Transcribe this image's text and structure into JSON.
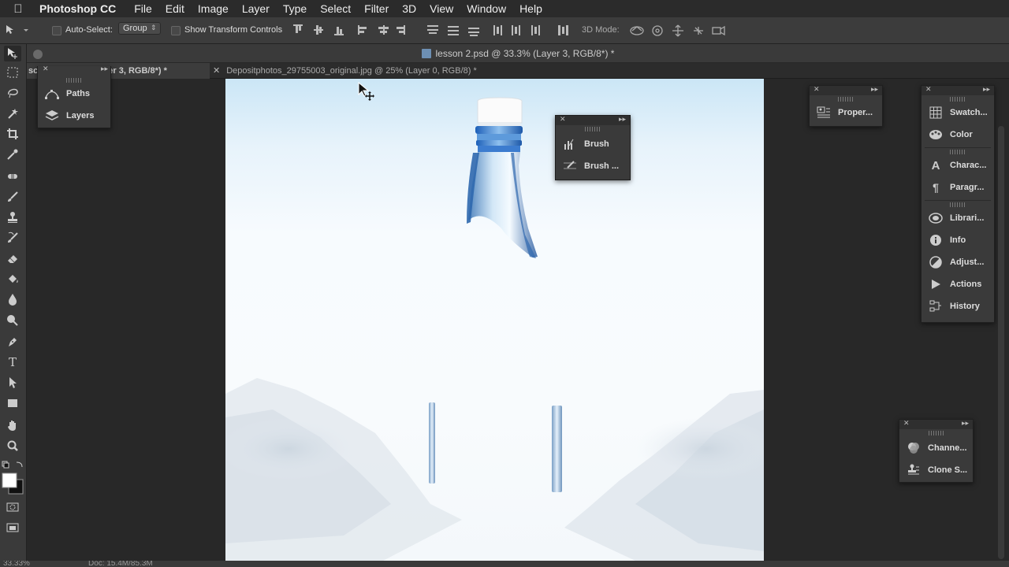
{
  "menubar": {
    "app": "Photoshop CC",
    "items": [
      "File",
      "Edit",
      "Image",
      "Layer",
      "Type",
      "Select",
      "Filter",
      "3D",
      "View",
      "Window",
      "Help"
    ]
  },
  "options": {
    "auto_select_label": "Auto-Select:",
    "auto_select_value": "Group",
    "show_transform_label": "Show Transform Controls",
    "mode_3d_label": "3D Mode:"
  },
  "document": {
    "window_title": "lesson 2.psd @ 33.3% (Layer 3, RGB/8*) *",
    "tabs": [
      {
        "label": "(Layer 3, RGB/8*) *",
        "partial_left": "sc"
      },
      {
        "label": "Depositphotos_29755003_original.jpg @ 25% (Layer 0, RGB/8) *"
      }
    ]
  },
  "panels": {
    "left_group": [
      {
        "label": "Paths",
        "icon": "paths-icon"
      },
      {
        "label": "Layers",
        "icon": "layers-icon"
      }
    ],
    "brush_group": [
      {
        "label": "Brush",
        "icon": "brush-icon"
      },
      {
        "label": "Brush ...",
        "icon": "brush-presets-icon"
      }
    ],
    "properties_group": [
      {
        "label": "Proper...",
        "icon": "properties-icon"
      }
    ],
    "right_group": [
      {
        "label": "Swatch...",
        "icon": "swatches-icon"
      },
      {
        "label": "Color",
        "icon": "color-icon"
      },
      {
        "label": "Charac...",
        "icon": "character-icon"
      },
      {
        "label": "Paragr...",
        "icon": "paragraph-icon"
      },
      {
        "label": "Librari...",
        "icon": "libraries-icon"
      },
      {
        "label": "Info",
        "icon": "info-icon"
      },
      {
        "label": "Adjust...",
        "icon": "adjustments-icon"
      },
      {
        "label": "Actions",
        "icon": "actions-icon"
      },
      {
        "label": "History",
        "icon": "history-icon"
      }
    ],
    "channels_group": [
      {
        "label": "Channe...",
        "icon": "channels-icon"
      },
      {
        "label": "Clone S...",
        "icon": "clone-source-icon"
      }
    ]
  },
  "status": {
    "zoom": "33.33%",
    "doc": "Doc: 15.4M/85.3M"
  }
}
